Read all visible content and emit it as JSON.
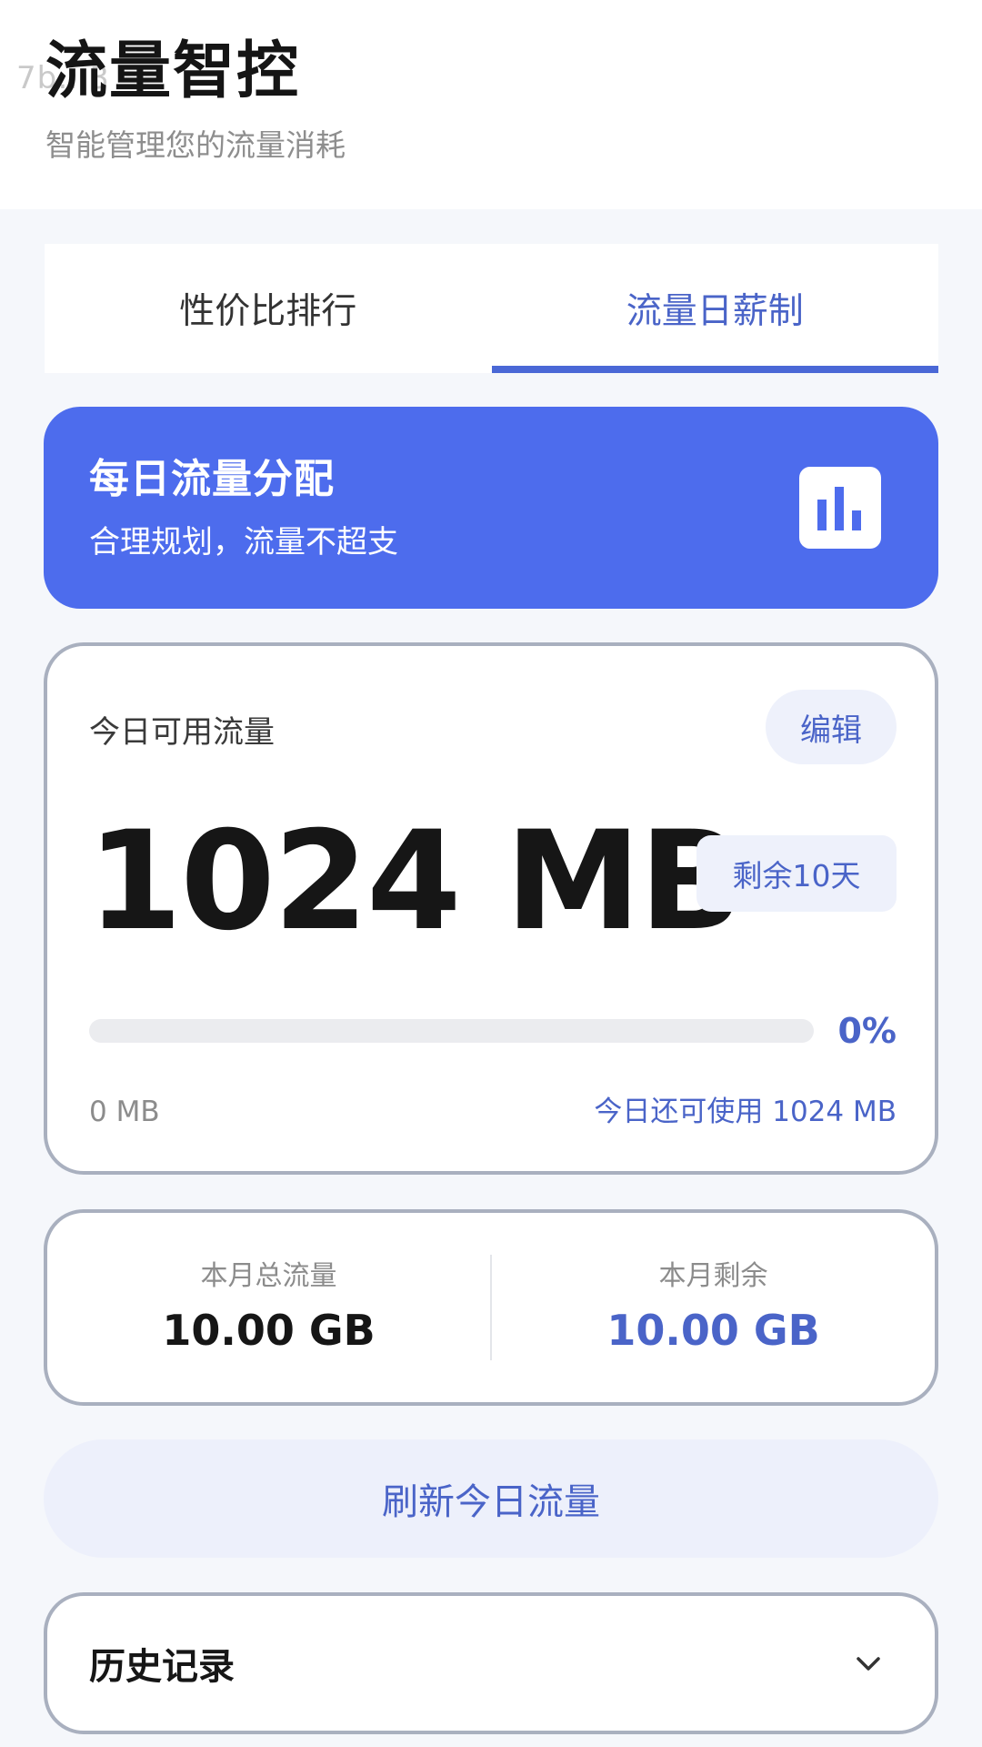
{
  "header": {
    "watermark": "7b…3",
    "title": "流量智控",
    "subtitle": "智能管理您的流量消耗"
  },
  "tabs": [
    {
      "label": "性价比排行",
      "active": false
    },
    {
      "label": "流量日薪制",
      "active": true
    }
  ],
  "banner": {
    "title": "每日流量分配",
    "subtitle": "合理规划，流量不超支",
    "icon": "bar-chart-icon",
    "color": "#4d6ced"
  },
  "today": {
    "label": "今日可用流量",
    "edit_label": "编辑",
    "amount": "1024 MB",
    "remaining_days": "剩余10天",
    "progress": 0,
    "progress_text": "0%",
    "used_text": "0 MB",
    "can_use_text": "今日还可使用 1024 MB"
  },
  "month": {
    "total_label": "本月总流量",
    "total_value": "10.00 GB",
    "remaining_label": "本月剩余",
    "remaining_value": "10.00 GB"
  },
  "refresh_label": "刷新今日流量",
  "history": {
    "label": "历史记录",
    "icon": "chevron-down-icon"
  },
  "colors": {
    "accent": "#4a64c8",
    "banner": "#4d6ced",
    "background": "#f5f7fb"
  }
}
